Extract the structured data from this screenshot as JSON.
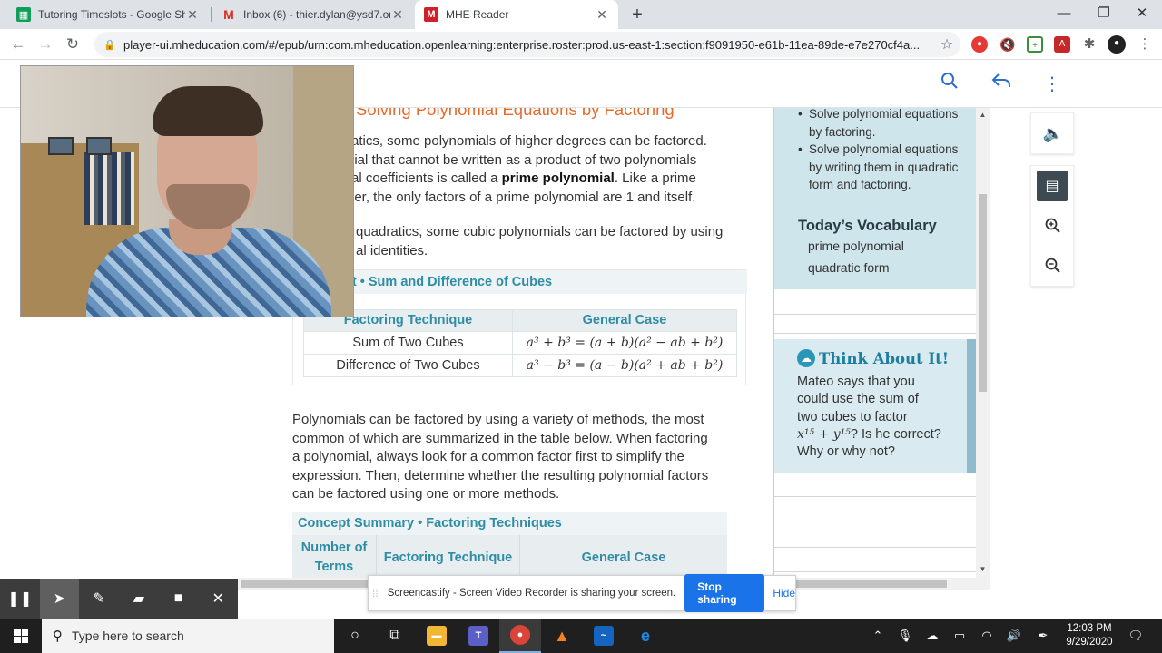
{
  "browser": {
    "tabs": [
      {
        "title": "Tutoring Timeslots - Google She",
        "icon": "sheets-icon",
        "color": "#0f9d58"
      },
      {
        "title": "Inbox (6) - thier.dylan@ysd7.org",
        "icon": "gmail-icon",
        "color": "#d93025"
      },
      {
        "title": "MHE Reader",
        "icon": "mhe-icon",
        "color": "#d0212a"
      }
    ],
    "url": "player-ui.mheducation.com/#/epub/urn:com.mheducation.openlearning:enterprise.roster:prod.us-east-1:section:f9091950-e61b-11ea-89de-e7e270cf4a..."
  },
  "lesson": {
    "heading": "Solving Polynomial Equations by Factoring",
    "para1_lines": [
      "ratics, some polynomials of higher degrees can be factored.",
      "nial that cannot be written as a product of two polynomials",
      "ral coefficients is called a ",
      "per, the only factors of a prime polynomial are 1 and itself."
    ],
    "para1_bold": "prime polynomial",
    "para1_after": ". Like a prime",
    "para2_lines": [
      "quadratics, some cubic polynomials can be factored by using",
      "al identities."
    ],
    "concept_title": "ept • Sum and Difference of Cubes",
    "table1": {
      "headers": [
        "Factoring Technique",
        "General Case"
      ],
      "rows": [
        {
          "technique": "Sum of Two Cubes",
          "general": "a³ + b³ = (a + b)(a² − ab + b²)"
        },
        {
          "technique": "Difference of Two Cubes",
          "general": "a³ − b³ = (a − b)(a² + ab + b²)"
        }
      ]
    },
    "para3_lines": [
      "Polynomials can be factored by using a variety of methods, the most",
      "common of which are summarized in the table below. When factoring",
      "a polynomial, always look for a common factor first to simplify the",
      "expression. Then, determine whether the resulting polynomial factors",
      "can be factored using one or more methods."
    ],
    "summary_title": "Concept Summary • Factoring Techniques",
    "summary_headers": [
      "Number of Terms",
      "Factoring Technique",
      "General Case"
    ]
  },
  "sidebar": {
    "objectives": [
      "Solve polynomial equations by factoring.",
      "Solve polynomial equations by writing them in quadratic form and factoring."
    ],
    "vocab_title": "Today’s Vocabulary",
    "vocab": [
      "prime polynomial",
      "quadratic form"
    ],
    "think_title": "Think About It!",
    "think_body_lines": [
      "Mateo says that you",
      "could use the sum of",
      "two cubes to factor"
    ],
    "think_math": "x¹⁵ + y¹⁵",
    "think_after": "? Is he correct?",
    "think_last": "Why or why not?"
  },
  "screencastify": {
    "message": "Screencastify - Screen Video Recorder is sharing your screen.",
    "stop_label": "Stop sharing",
    "hide_label": "Hide"
  },
  "taskbar": {
    "search_placeholder": "Type here to search",
    "time": "12:03 PM",
    "date": "9/29/2020"
  }
}
